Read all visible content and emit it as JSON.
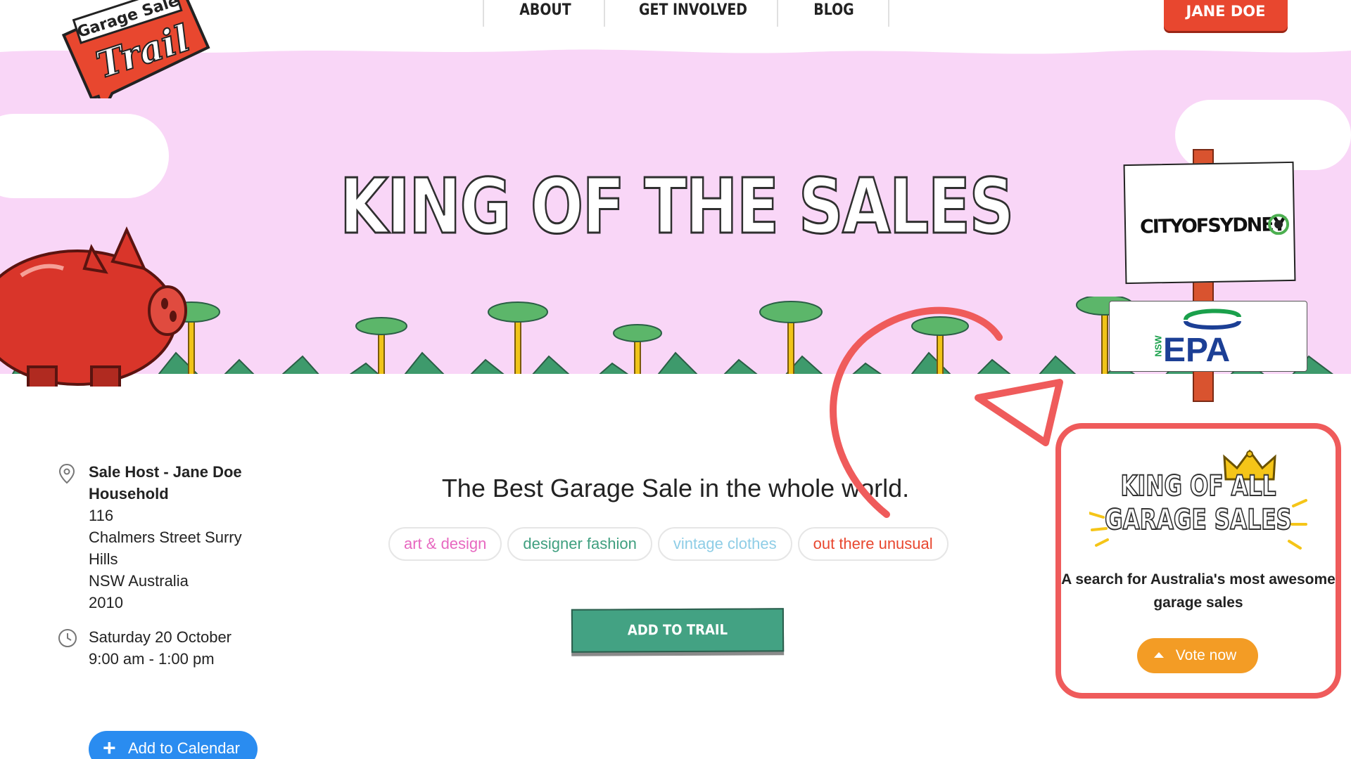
{
  "nav": {
    "items": [
      "ABOUT",
      "GET INVOLVED",
      "BLOG"
    ],
    "user_label": "JANE DOE"
  },
  "logo": {
    "line1": "Garage Sale",
    "line2": "Trail"
  },
  "hero": {
    "title": "KING OF THE SALES"
  },
  "sponsors": {
    "sydney": "CITYOFSYDNEY",
    "epa": "EPA",
    "epa_prefix": "NSW"
  },
  "details": {
    "host": "Sale Host - Jane Doe Household",
    "address": [
      "116",
      "Chalmers Street Surry",
      "Hills",
      "NSW Australia",
      "2010"
    ],
    "date": "Saturday 20 October",
    "time": "9:00 am - 1:00 pm",
    "calendar_label": "Add to Calendar"
  },
  "main": {
    "tagline": "The Best Garage Sale in the whole world.",
    "tags": [
      {
        "label": "art & design",
        "color": "#e768c0"
      },
      {
        "label": "designer fashion",
        "color": "#3f9f7f"
      },
      {
        "label": "vintage clothes",
        "color": "#8ecde6"
      },
      {
        "label": "out there unusual",
        "color": "#e8472f"
      }
    ],
    "add_trail_label": "ADD TO TRAIL"
  },
  "king": {
    "title_line1": "KING OF ALL",
    "title_line2": "GARAGE SALES",
    "description": "A search for Australia's most awesome garage sales",
    "vote_label": "Vote now"
  },
  "colors": {
    "hero_bg": "#f9d6f7",
    "accent_red": "#e8472f",
    "annotation": "#ef5b5b",
    "green": "#43a283",
    "vote_orange": "#f39c25",
    "calendar_blue": "#2a8cf0"
  }
}
